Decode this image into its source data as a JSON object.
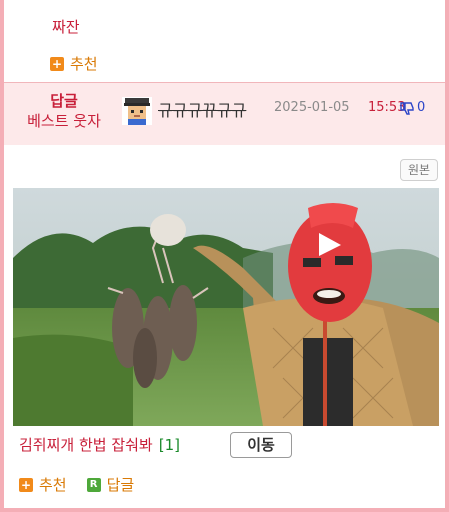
{
  "post": {
    "title": "짜잔",
    "recommend_label": "추천"
  },
  "reply": {
    "badge_line1": "답글",
    "badge_line2": "베스트 웃자",
    "nickname": "규규규뀨규규",
    "date": "2025-01-05",
    "time": "15:53",
    "dislike_count": "0"
  },
  "content": {
    "original_button": "원본",
    "caption": "김쥐찌개 한법 잡숴봐",
    "comment_count": "[1]",
    "move_button": "이동",
    "recommend_label": "추천",
    "reply_label": "답글"
  },
  "colors": {
    "accent_red": "#c8203a",
    "orange": "#d97a06",
    "band": "#fde9ea",
    "frame": "#f4aeb6"
  }
}
